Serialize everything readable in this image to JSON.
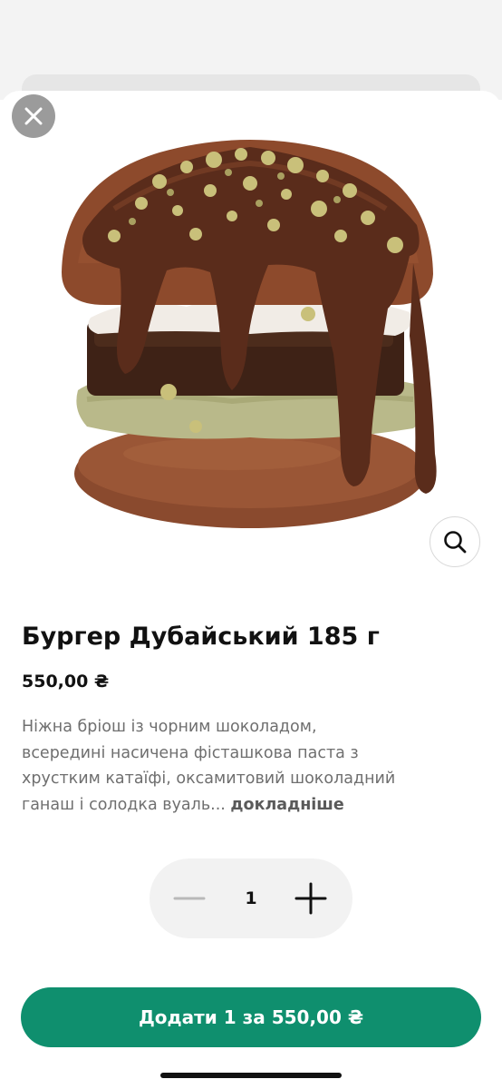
{
  "product": {
    "title": "Бургер Дубайський 185 г",
    "price": "550,00 ₴",
    "description_lines": [
      "Ніжна бріош із чорним шоколадом,",
      "всередині насичена фісташкова паста з",
      "хрустким катаїфі, оксамитовий шоколадний",
      "ганаш і солодка вуаль..."
    ],
    "more_label": "докладніше",
    "image_icon": "burger-photo"
  },
  "stepper": {
    "quantity": "1"
  },
  "add_button": {
    "label": "Додати 1 за 550,00 ₴"
  },
  "icons": {
    "close": "close-icon",
    "zoom": "search-icon",
    "minus": "minus-icon",
    "plus": "plus-icon"
  },
  "colors": {
    "accent": "#0f8f6e",
    "close_bg": "#9b9b9b",
    "stepper_bg": "#f2f2f2",
    "description": "#6f6f6f"
  }
}
